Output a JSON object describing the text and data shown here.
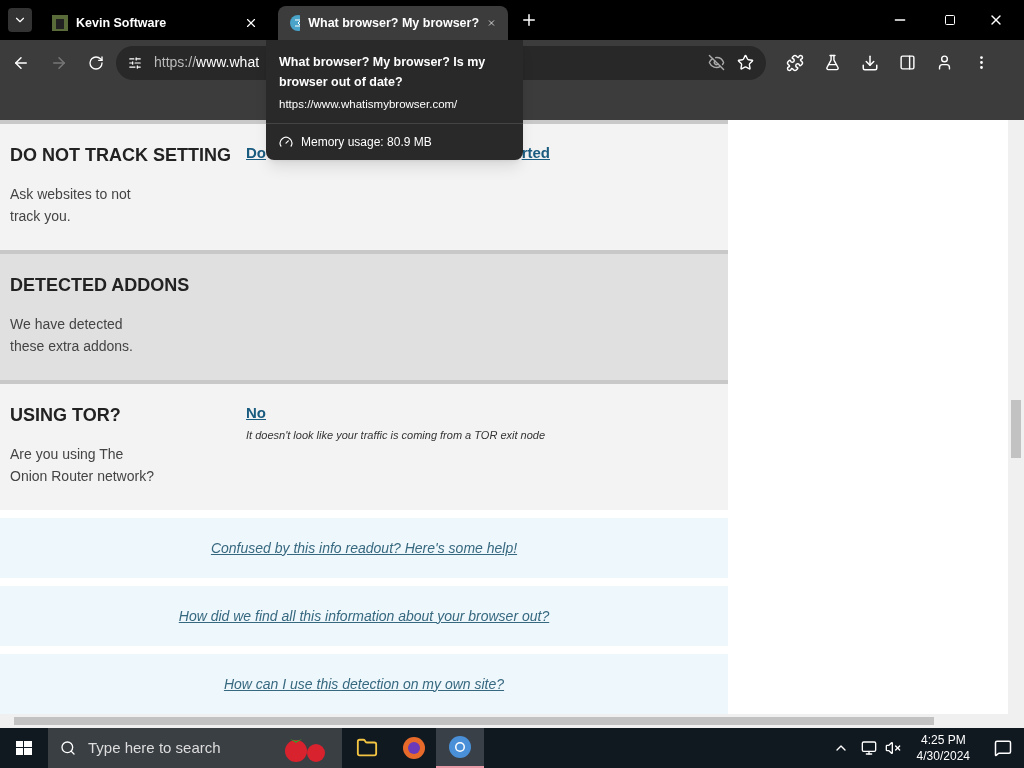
{
  "tabs": [
    {
      "title": "Kevin Software",
      "selected": false
    },
    {
      "title": "What browser? My browser?",
      "selected": true
    }
  ],
  "address": {
    "visible_text_start": "https://",
    "visible_text_bold": "www.what"
  },
  "tooltip": {
    "title": "What browser? My browser? Is my browser out of date?",
    "url": "https://www.whatismybrowser.com/",
    "memory": "Memory usage: 80.9 MB"
  },
  "sections": [
    {
      "heading": "DO NOT TRACK SETTING",
      "description": "Ask websites to not track you.",
      "kind": "light",
      "value_parts": [
        "Do",
        "rted"
      ]
    },
    {
      "heading": "DETECTED ADDONS",
      "description": "We have detected these extra addons.",
      "kind": "dark"
    },
    {
      "heading": "USING TOR?",
      "description": "Are you using The Onion Router network?",
      "kind": "light",
      "value_parts": [
        "No"
      ],
      "note": "It doesn't look like your traffic is coming from a TOR exit node"
    }
  ],
  "help_links": [
    "Confused by this info readout? Here's some help!",
    "How did we find all this information about your browser out?",
    "How can I use this detection on my own site?"
  ],
  "taskbar": {
    "search_placeholder": "Type here to search",
    "time": "4:25 PM",
    "date": "4/30/2024"
  }
}
